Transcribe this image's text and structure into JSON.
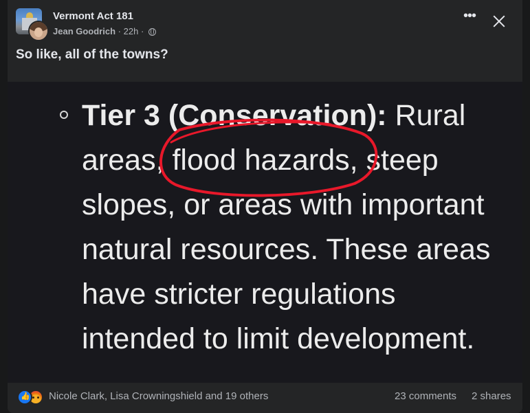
{
  "post": {
    "group_name": "Vermont Act 181",
    "author": "Jean Goodrich",
    "time": "22h",
    "separator": "·",
    "text": "So like, all of the towns?"
  },
  "image": {
    "lines": [
      {
        "bold": "Tier 3 (Conservation):",
        "rest": " Rural"
      },
      {
        "bold": "",
        "rest": "areas, flood hazards, steep"
      },
      {
        "bold": "",
        "rest": "slopes, or areas with important"
      },
      {
        "bold": "",
        "rest": "natural resources. These areas"
      },
      {
        "bold": "",
        "rest": "have stricter regulations"
      },
      {
        "bold": "",
        "rest": "intended to limit development."
      }
    ],
    "annotation_color": "#e8182a"
  },
  "footer": {
    "reactors": "Nicole Clark, Lisa Crowningshield and 19 others",
    "comments": "23 comments",
    "shares": "2 shares"
  },
  "icons": [
    "like-icon",
    "angry-icon",
    "globe-icon",
    "more-icon",
    "close-icon"
  ],
  "colors": {
    "card_bg": "#242526",
    "image_bg": "#18181d",
    "text_primary": "#e4e6eb",
    "text_secondary": "#b0b3b8"
  }
}
